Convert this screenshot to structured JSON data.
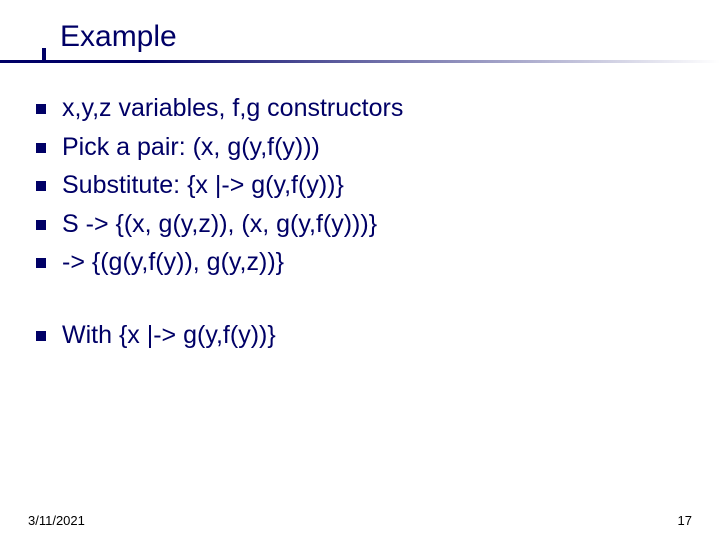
{
  "title": "Example",
  "bullets_group1": [
    "x,y,z variables, f,g constructors",
    "Pick a pair: (x, g(y,f(y)))",
    "Substitute: {x |-> g(y,f(y))}",
    "S -> {(x, g(y,z)), (x, g(y,f(y)))}",
    "-> {(g(y,f(y)), g(y,z))}"
  ],
  "bullets_group2": [
    "With {x |-> g(y,f(y))}"
  ],
  "footer": {
    "date": "3/11/2021",
    "page": "17"
  }
}
